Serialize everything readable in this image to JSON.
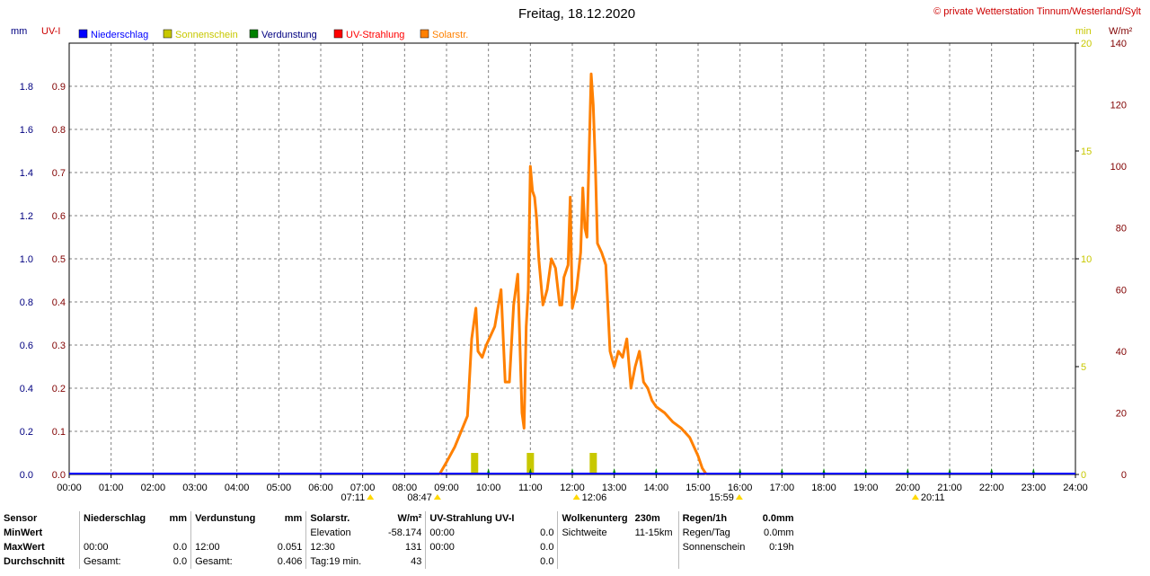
{
  "header": {
    "title": "Freitag, 18.12.2020",
    "copyright": "© private Wetterstation Tinnum/Westerland/Sylt"
  },
  "legend": [
    {
      "label": "Niederschlag",
      "color": "#0000ff",
      "text_color": "#0000ff"
    },
    {
      "label": "Sonnenschein",
      "color": "#c8c800",
      "text_color": "#c8c800"
    },
    {
      "label": "Verdunstung",
      "color": "#008000",
      "text_color": "#000080"
    },
    {
      "label": "UV-Strahlung",
      "color": "#ff0000",
      "text_color": "#ff0000"
    },
    {
      "label": "Solarstr.",
      "color": "#ff8000",
      "text_color": "#ff8000"
    }
  ],
  "axes": {
    "mm": {
      "label": "mm",
      "ticks": [
        "0.0",
        "0.2",
        "0.4",
        "0.6",
        "0.8",
        "1.0",
        "1.2",
        "1.4",
        "1.6",
        "1.8"
      ],
      "color": "#000080"
    },
    "uvi": {
      "label": "UV-I",
      "ticks": [
        "0.0",
        "0.1",
        "0.2",
        "0.3",
        "0.4",
        "0.5",
        "0.6",
        "0.7",
        "0.8",
        "0.9"
      ],
      "color": "#800000"
    },
    "min": {
      "label": "min",
      "ticks": [
        "0",
        "5",
        "10",
        "15",
        "20"
      ],
      "color": "#c8c800"
    },
    "wm2": {
      "label": "W/m²",
      "ticks": [
        "0",
        "20",
        "40",
        "60",
        "80",
        "100",
        "120",
        "140"
      ],
      "color": "#800000"
    },
    "x_ticks": [
      "00:00",
      "01:00",
      "02:00",
      "03:00",
      "04:00",
      "05:00",
      "06:00",
      "07:00",
      "08:00",
      "09:00",
      "10:00",
      "11:00",
      "12:00",
      "13:00",
      "14:00",
      "15:00",
      "16:00",
      "17:00",
      "18:00",
      "19:00",
      "20:00",
      "21:00",
      "22:00",
      "23:00",
      "24:00"
    ]
  },
  "sun_events": [
    {
      "label": "07:11",
      "hour": 7.183,
      "side": "left"
    },
    {
      "label": "08:47",
      "hour": 8.783,
      "side": "left"
    },
    {
      "label": "12:06",
      "hour": 12.1,
      "side": "right"
    },
    {
      "label": "15:59",
      "hour": 15.983,
      "side": "left"
    },
    {
      "label": "20:11",
      "hour": 20.183,
      "side": "right"
    }
  ],
  "chart_data": {
    "type": "line",
    "x_unit": "hour",
    "xlim": [
      0,
      24
    ],
    "series": [
      {
        "name": "Solarstr.",
        "axis": "W/m²",
        "ylim": [
          0,
          140
        ],
        "x": [
          8.83,
          9.0,
          9.2,
          9.35,
          9.5,
          9.6,
          9.7,
          9.75,
          9.85,
          9.95,
          10.05,
          10.15,
          10.3,
          10.4,
          10.5,
          10.6,
          10.7,
          10.8,
          10.85,
          10.9,
          10.95,
          11.0,
          11.05,
          11.1,
          11.15,
          11.2,
          11.3,
          11.4,
          11.5,
          11.6,
          11.7,
          11.75,
          11.8,
          11.9,
          11.95,
          12.0,
          12.1,
          12.2,
          12.25,
          12.3,
          12.35,
          12.45,
          12.5,
          12.55,
          12.6,
          12.7,
          12.8,
          12.9,
          13.0,
          13.1,
          13.2,
          13.3,
          13.4,
          13.5,
          13.6,
          13.7,
          13.8,
          13.9,
          14.0,
          14.2,
          14.4,
          14.6,
          14.8,
          15.0,
          15.1,
          15.2
        ],
        "values": [
          0,
          4,
          9,
          14,
          19,
          44,
          54,
          40,
          38,
          42,
          45,
          48,
          60,
          30,
          30,
          55,
          65,
          20,
          15,
          48,
          60,
          100,
          92,
          90,
          83,
          70,
          55,
          60,
          70,
          67,
          55,
          55,
          64,
          68,
          90,
          54,
          60,
          72,
          93,
          80,
          77,
          130,
          120,
          100,
          75,
          72,
          68,
          40,
          35,
          40,
          38,
          44,
          28,
          35,
          40,
          30,
          28,
          24,
          22,
          20,
          17,
          15,
          12,
          6,
          2,
          0
        ]
      },
      {
        "name": "Sonnenschein",
        "axis": "min",
        "ylim": [
          0,
          20
        ],
        "x": [
          9.67,
          11.0,
          12.5
        ],
        "values": [
          1,
          1,
          1
        ]
      },
      {
        "name": "Niederschlag",
        "axis": "mm",
        "ylim": [
          0,
          2
        ],
        "x": [
          0,
          24
        ],
        "values": [
          0.0,
          0.0
        ]
      }
    ]
  },
  "stats": {
    "headers": [
      "Sensor",
      "Niederschlag",
      "mm",
      "Verdunstung",
      "mm",
      "Solarstr.",
      "W/m²",
      "UV-Strahlung UV-I",
      "",
      "Wolkenunterg",
      "230m",
      "Regen/1h",
      "0.0mm"
    ],
    "rows": [
      [
        "MinWert",
        "",
        "",
        "",
        "",
        "Elevation",
        "-58.174",
        "00:00",
        "0.0",
        "Sichtweite",
        "11-15km",
        "Regen/Tag",
        "0.0mm"
      ],
      [
        "MaxWert",
        "00:00",
        "0.0",
        "12:00",
        "0.051",
        "12:30",
        "131",
        "00:00",
        "0.0",
        "",
        "",
        "Sonnenschein",
        "0:19h"
      ],
      [
        "Durchschnitt",
        "Gesamt:",
        "0.0",
        "Gesamt:",
        "0.406",
        "Tag:19 min.",
        "43",
        "",
        "0.0",
        "",
        "",
        "",
        ""
      ]
    ]
  }
}
